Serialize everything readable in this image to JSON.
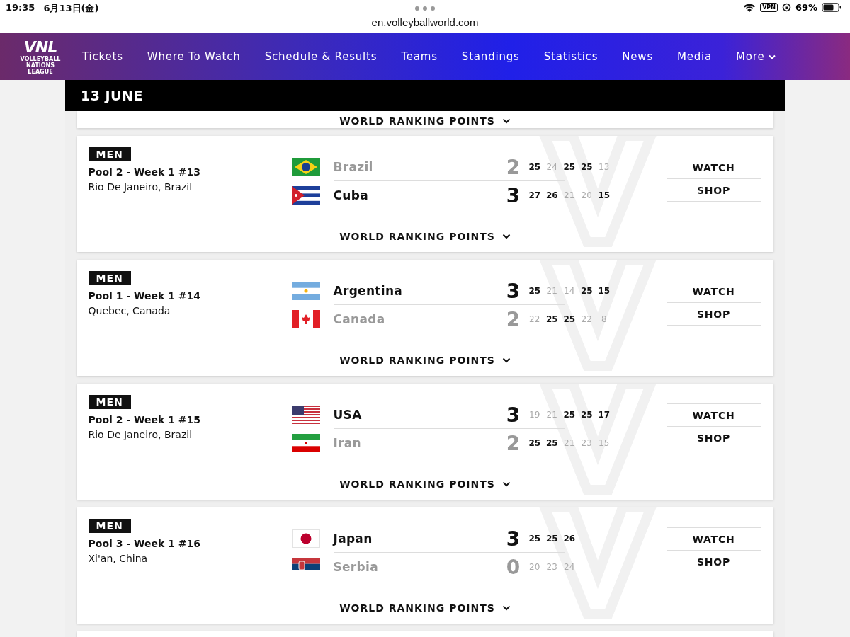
{
  "status_bar": {
    "time": "19:35",
    "date": "6月13日(金)",
    "vpn": "VPN",
    "battery": "69%"
  },
  "address_bar": {
    "url": "en.volleyballworld.com"
  },
  "nav": {
    "logo": {
      "mark": "VNL",
      "caption": "VOLLEYBALL NATIONS LEAGUE"
    },
    "items": [
      {
        "label": "Tickets",
        "dropdown": false
      },
      {
        "label": "Where To Watch",
        "dropdown": false
      },
      {
        "label": "Schedule & Results",
        "dropdown": false
      },
      {
        "label": "Teams",
        "dropdown": false
      },
      {
        "label": "Standings",
        "dropdown": false
      },
      {
        "label": "Statistics",
        "dropdown": false
      },
      {
        "label": "News",
        "dropdown": false
      },
      {
        "label": "Media",
        "dropdown": false
      },
      {
        "label": "More",
        "dropdown": true
      }
    ]
  },
  "day_header": "13 JUNE",
  "previous_card": {
    "toggle": "WORLD RANKING POINTS"
  },
  "matches": [
    {
      "category": "MEN",
      "pool": "Pool 2 - Week 1 #13",
      "location": "Rio De Janeiro, Brazil",
      "toggle": "WORLD RANKING POINTS",
      "buttons": [
        "WATCH",
        "SHOP"
      ],
      "teams": [
        {
          "name": "Brazil",
          "kind": "brazil",
          "winner": false,
          "score": "2",
          "sets": [
            {
              "points": "25",
              "won": true
            },
            {
              "points": "24",
              "won": false
            },
            {
              "points": "25",
              "won": true
            },
            {
              "points": "25",
              "won": true
            },
            {
              "points": "13",
              "won": false
            }
          ]
        },
        {
          "name": "Cuba",
          "kind": "cuba",
          "winner": true,
          "score": "3",
          "sets": [
            {
              "points": "27",
              "won": true
            },
            {
              "points": "26",
              "won": true
            },
            {
              "points": "21",
              "won": false
            },
            {
              "points": "20",
              "won": false
            },
            {
              "points": "15",
              "won": true
            }
          ]
        }
      ]
    },
    {
      "category": "MEN",
      "pool": "Pool 1 - Week 1 #14",
      "location": "Quebec, Canada",
      "toggle": "WORLD RANKING POINTS",
      "buttons": [
        "WATCH",
        "SHOP"
      ],
      "teams": [
        {
          "name": "Argentina",
          "kind": "argentina",
          "winner": true,
          "score": "3",
          "sets": [
            {
              "points": "25",
              "won": true
            },
            {
              "points": "21",
              "won": false
            },
            {
              "points": "14",
              "won": false
            },
            {
              "points": "25",
              "won": true
            },
            {
              "points": "15",
              "won": true
            }
          ]
        },
        {
          "name": "Canada",
          "kind": "canada",
          "winner": false,
          "score": "2",
          "sets": [
            {
              "points": "22",
              "won": false
            },
            {
              "points": "25",
              "won": true
            },
            {
              "points": "25",
              "won": true
            },
            {
              "points": "22",
              "won": false
            },
            {
              "points": "8",
              "won": false
            }
          ]
        }
      ]
    },
    {
      "category": "MEN",
      "pool": "Pool 2 - Week 1 #15",
      "location": "Rio De Janeiro, Brazil",
      "toggle": "WORLD RANKING POINTS",
      "buttons": [
        "WATCH",
        "SHOP"
      ],
      "teams": [
        {
          "name": "USA",
          "kind": "usa",
          "winner": true,
          "score": "3",
          "sets": [
            {
              "points": "19",
              "won": false
            },
            {
              "points": "21",
              "won": false
            },
            {
              "points": "25",
              "won": true
            },
            {
              "points": "25",
              "won": true
            },
            {
              "points": "17",
              "won": true
            }
          ]
        },
        {
          "name": "Iran",
          "kind": "iran",
          "winner": false,
          "score": "2",
          "sets": [
            {
              "points": "25",
              "won": true
            },
            {
              "points": "25",
              "won": true
            },
            {
              "points": "21",
              "won": false
            },
            {
              "points": "23",
              "won": false
            },
            {
              "points": "15",
              "won": false
            }
          ]
        }
      ]
    },
    {
      "category": "MEN",
      "pool": "Pool 3 - Week 1 #16",
      "location": "Xi'an, China",
      "toggle": "WORLD RANKING POINTS",
      "buttons": [
        "WATCH",
        "SHOP"
      ],
      "teams": [
        {
          "name": "Japan",
          "kind": "japan",
          "winner": true,
          "score": "3",
          "sets": [
            {
              "points": "25",
              "won": true
            },
            {
              "points": "25",
              "won": true
            },
            {
              "points": "26",
              "won": true
            }
          ]
        },
        {
          "name": "Serbia",
          "kind": "serbia",
          "winner": false,
          "score": "0",
          "sets": [
            {
              "points": "20",
              "won": false
            },
            {
              "points": "23",
              "won": false
            },
            {
              "points": "24",
              "won": false
            }
          ]
        }
      ]
    }
  ]
}
